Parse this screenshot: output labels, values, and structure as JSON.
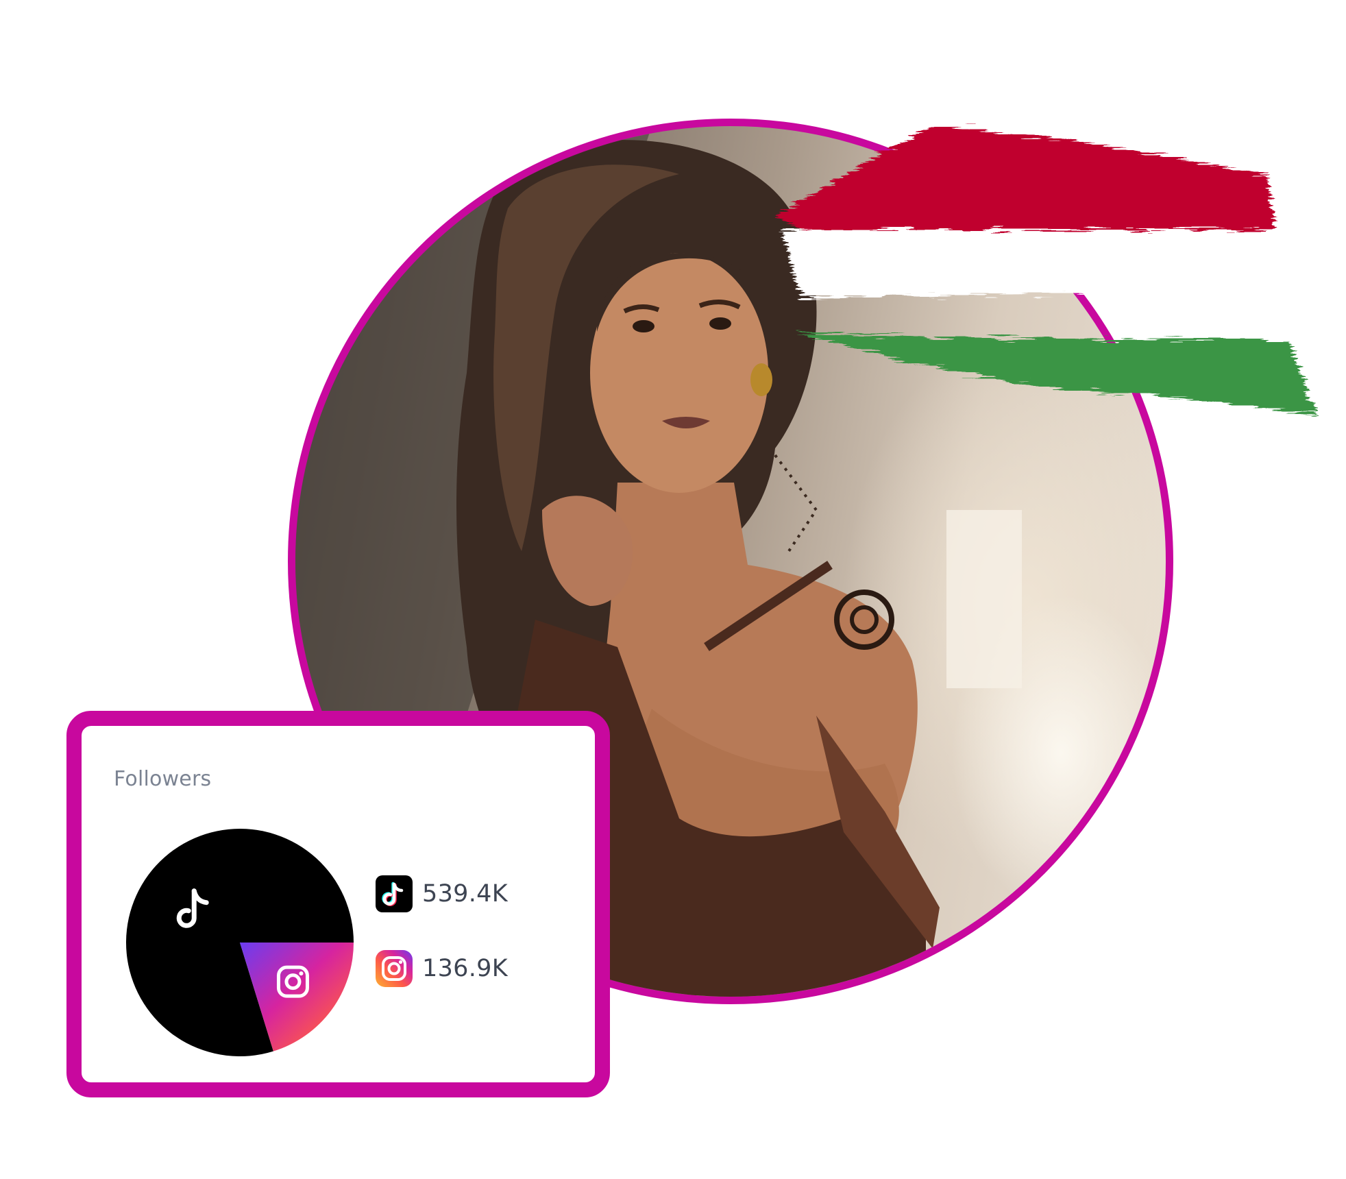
{
  "profile": {
    "photo_icon": "person-portrait-photo",
    "ring_color": "#c8089e"
  },
  "flag": {
    "icon": "hungary-flag-brush",
    "colors": [
      "#c0002e",
      "#ffffff",
      "#3b9544"
    ]
  },
  "followers_card": {
    "title": "Followers",
    "border_color": "#c8089e",
    "platforms": [
      {
        "name": "TikTok",
        "icon": "tiktok-icon",
        "value_label": "539.4K",
        "value": 539.4,
        "color": "#000000"
      },
      {
        "name": "Instagram",
        "icon": "instagram-icon",
        "value_label": "136.9K",
        "value": 136.9,
        "color": "instagram-gradient"
      }
    ]
  },
  "chart_data": {
    "type": "pie",
    "title": "Followers",
    "unit": "K",
    "slices": [
      {
        "label": "TikTok",
        "value": 539.4
      },
      {
        "label": "Instagram",
        "value": 136.9
      }
    ]
  }
}
